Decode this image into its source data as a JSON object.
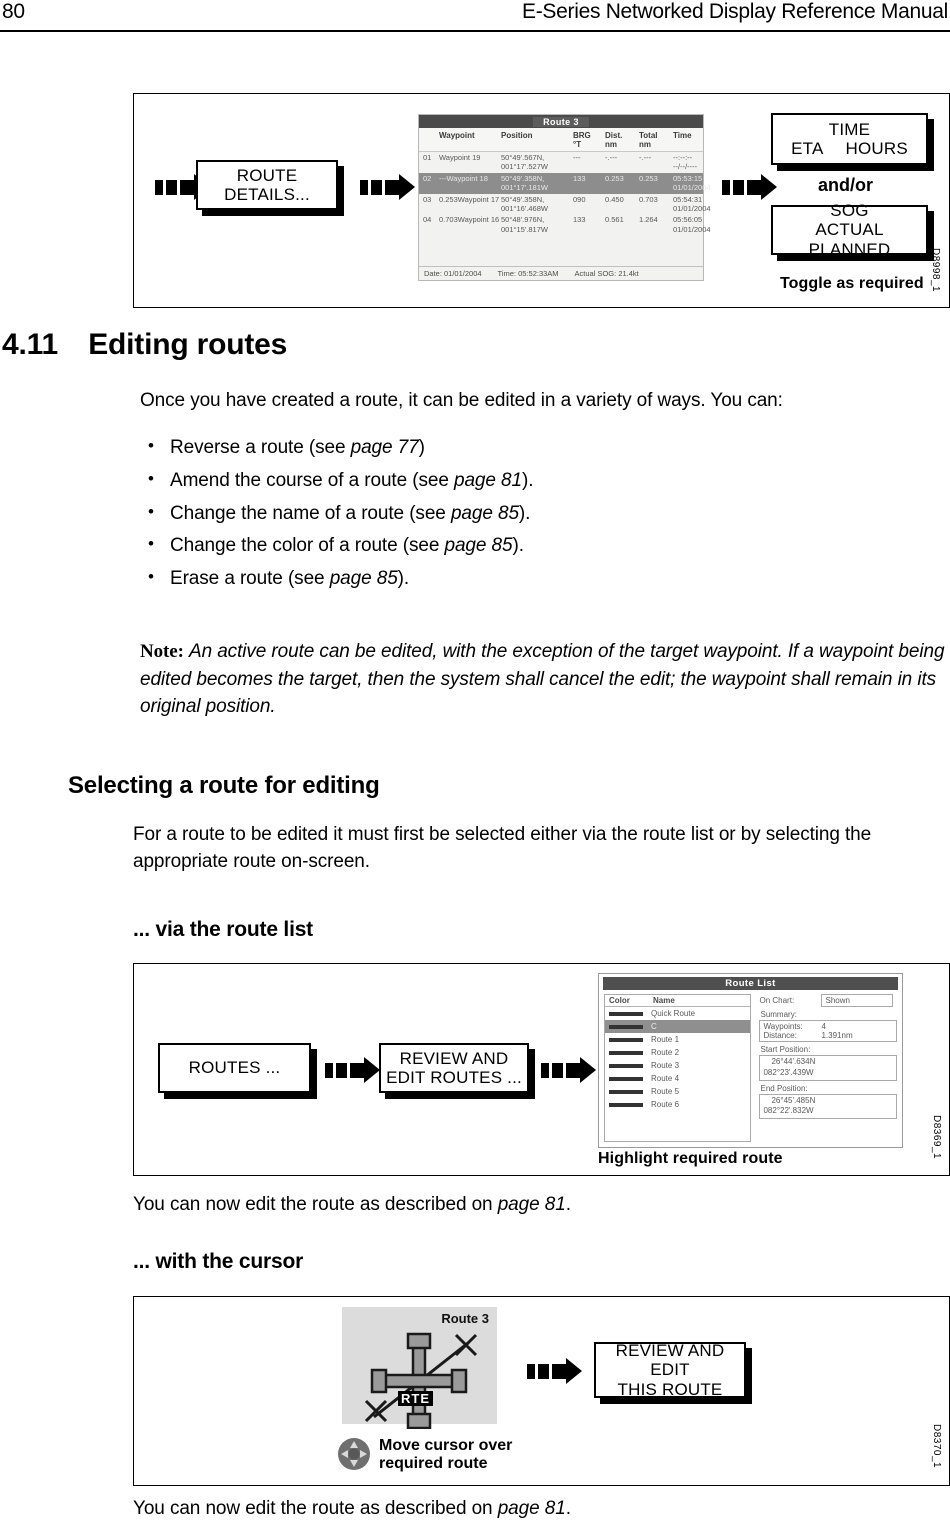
{
  "header": {
    "page_number": "80",
    "manual_title": "E-Series Networked Display Reference Manual"
  },
  "figure_route_details": {
    "code": "D8998_1",
    "softkey_route_details": "ROUTE DETAILS...",
    "softkey_time": {
      "line1": "TIME",
      "line2_left": "ETA",
      "line2_right": "HOURS"
    },
    "and_or": "and/or",
    "softkey_sog": {
      "line1": "SOG",
      "line2": "ACTUAL PLANNED"
    },
    "caption": "Toggle as required",
    "screen": {
      "title": "Route 3",
      "columns": [
        "",
        "Waypoint",
        "Position",
        "BRG\n°T",
        "Dist.\nnm",
        "Total\nnm",
        "Time"
      ],
      "col_headers": {
        "waypoint": "Waypoint",
        "position": "Position",
        "brg": "BRG",
        "brg_unit": "°T",
        "dist": "Dist.",
        "dist_unit": "nm",
        "total": "Total",
        "total_unit": "nm",
        "time": "Time"
      },
      "rows": [
        {
          "idx": "01",
          "waypoint": "Waypoint 19",
          "pos1": "50°49'.567N,",
          "pos2": "001°17'.527W",
          "brg": "---",
          "dist": "-.---",
          "total": "-.---",
          "time1": "--:--:--",
          "time2": "--/--/----",
          "selected": false
        },
        {
          "idx": "02",
          "waypoint": "---Waypoint 18",
          "pos1": "50°49'.358N,",
          "pos2": "001°17'.181W",
          "brg": "133",
          "dist": "0.253",
          "total": "0.253",
          "time1": "05:53:15",
          "time2": "01/01/2004",
          "selected": true
        },
        {
          "idx": "03",
          "waypoint": "0.253Waypoint 17",
          "pos1": "50°49'.358N,",
          "pos2": "001°16'.468W",
          "brg": "090",
          "dist": "0.450",
          "total": "0.703",
          "time1": "05:54:31",
          "time2": "01/01/2004",
          "selected": false
        },
        {
          "idx": "04",
          "waypoint": "0.703Waypoint 16",
          "pos1": "50°48'.976N,",
          "pos2": "001°15'.817W",
          "brg": "133",
          "dist": "0.561",
          "total": "1.264",
          "time1": "05:56:05",
          "time2": "01/01/2004",
          "selected": false
        }
      ],
      "footer": {
        "date": "Date: 01/01/2004",
        "time": "Time: 05:52:33AM",
        "sog": "Actual SOG: 21.4kt"
      }
    }
  },
  "section": {
    "number": "4.11",
    "title": "Editing routes",
    "intro": "Once you have created a route, it can be edited in a variety of ways. You can:",
    "bullets": [
      {
        "text_before": "Reverse a route (see ",
        "page_ref": "page 77",
        "text_after": ")"
      },
      {
        "text_before": "Amend the course of a route (see ",
        "page_ref": "page 81",
        "text_after": ")."
      },
      {
        "text_before": "Change the name of a route (see ",
        "page_ref": "page 85",
        "text_after": ")."
      },
      {
        "text_before": "Change the color of a route (see ",
        "page_ref": "page 85",
        "text_after": ")."
      },
      {
        "text_before": "Erase a route (see ",
        "page_ref": "page 85",
        "text_after": ")."
      }
    ],
    "note_label": "Note:",
    "note_text": "An active route can be edited, with the exception of the target waypoint. If a waypoint being edited becomes the target, then the system shall cancel the edit; the waypoint shall remain in its original position."
  },
  "selecting": {
    "heading": "Selecting a route for editing",
    "paragraph": "For a route to be edited it must first be selected either via the route list or by selecting the appropriate route on-screen.",
    "sub_heading_list": "... via the route list",
    "sub_heading_cursor": "... with the cursor",
    "after_list_text_before": "You can now edit the route as described on ",
    "after_list_page_ref": "page 81",
    "after_list_text_after": ".",
    "after_cursor_text_before": "You can now edit the route as described on ",
    "after_cursor_page_ref": "page 81",
    "after_cursor_text_after": "."
  },
  "figure_route_list": {
    "code": "D8369_1",
    "softkey_routes": "ROUTES ...",
    "softkey_review_edit": {
      "line1": "REVIEW AND",
      "line2": "EDIT ROUTES ..."
    },
    "caption": "Highlight required route",
    "screen": {
      "title": "Route List",
      "col_color": "Color",
      "col_name": "Name",
      "routes": [
        {
          "name": "Quick Route",
          "selected": false
        },
        {
          "name": "C",
          "selected": true
        },
        {
          "name": "Route 1",
          "selected": false
        },
        {
          "name": "Route 2",
          "selected": false
        },
        {
          "name": "Route 3",
          "selected": false
        },
        {
          "name": "Route 4",
          "selected": false
        },
        {
          "name": "Route 5",
          "selected": false
        },
        {
          "name": "Route 6",
          "selected": false
        }
      ],
      "on_chart_label": "On Chart:",
      "on_chart_value": "Shown",
      "summary_label": "Summary:",
      "waypoints_label": "Waypoints:",
      "waypoints_value": "4",
      "distance_label": "Distance:",
      "distance_value": "1.391nm",
      "start_position_label": "Start Position:",
      "start_position_line1": "26°44'.634N",
      "start_position_line2": "082°23'.439W",
      "end_position_label": "End Position:",
      "end_position_line1": "26°45'.485N",
      "end_position_line2": "082°22'.832W"
    }
  },
  "figure_cursor": {
    "code": "D8370_1",
    "chart_route_label": "Route 3",
    "rte_tag": "RTE",
    "softkey_review_edit_this": {
      "line1": "REVIEW AND EDIT",
      "line2": "THIS ROUTE"
    },
    "caption_line1": "Move cursor over",
    "caption_line2": "required route"
  },
  "colors": {
    "ink": "#000000",
    "screen_bg": "#f2f2f0",
    "screen_title_bar": "#4a4a4a",
    "selected_row": "#8d8d8d",
    "chart_bg": "#dcdcdc",
    "trackpad": "#6b6b6b"
  }
}
